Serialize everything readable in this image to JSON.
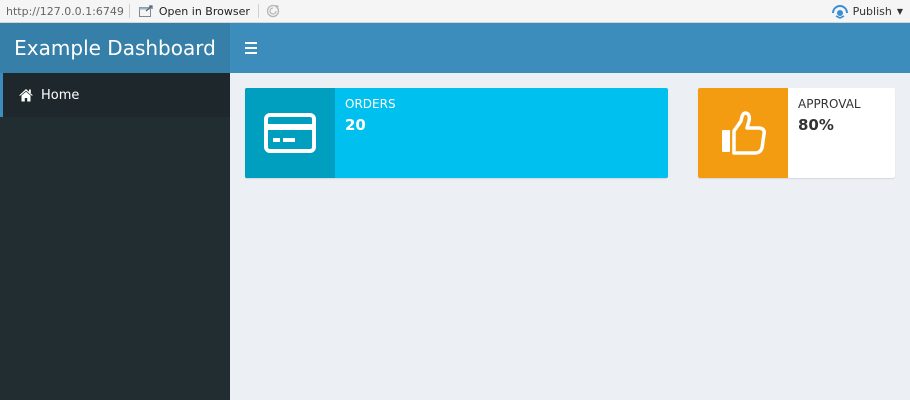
{
  "browser": {
    "url": "http://127.0.0.1:6749",
    "open_in_browser": "Open in Browser",
    "publish": "Publish"
  },
  "header": {
    "title": "Example Dashboard"
  },
  "sidebar": {
    "items": [
      {
        "label": "Home",
        "icon": "home-icon"
      }
    ]
  },
  "infoboxes": [
    {
      "label": "ORDERS",
      "value": "20",
      "icon": "credit-card-icon",
      "color": "#00c0ef",
      "icon_bg": "#009ebf"
    },
    {
      "label": "APPROVAL",
      "value": "80%",
      "icon": "thumbs-up-icon",
      "color": "#ffffff",
      "icon_bg": "#f39c12"
    }
  ],
  "colors": {
    "header_logo": "#367fa9",
    "navbar": "#3c8dbc",
    "sidebar": "#222d32",
    "content_bg": "#ecf0f5"
  }
}
